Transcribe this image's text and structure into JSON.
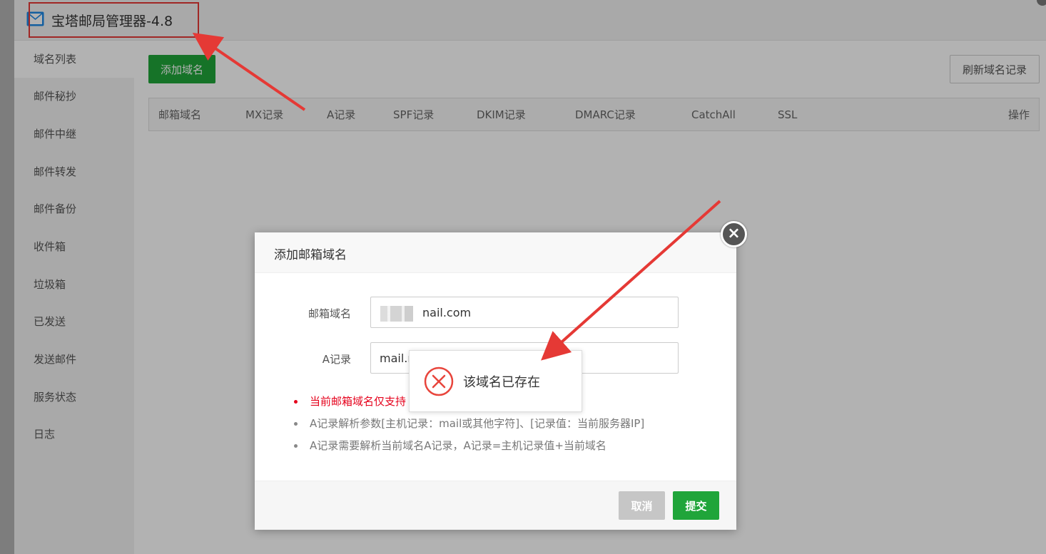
{
  "window": {
    "title": "宝塔邮局管理器-4.8"
  },
  "sidebar": {
    "items": [
      {
        "label": "域名列表"
      },
      {
        "label": "邮件秘抄"
      },
      {
        "label": "邮件中继"
      },
      {
        "label": "邮件转发"
      },
      {
        "label": "邮件备份"
      },
      {
        "label": "收件箱"
      },
      {
        "label": "垃圾箱"
      },
      {
        "label": "已发送"
      },
      {
        "label": "发送邮件"
      },
      {
        "label": "服务状态"
      },
      {
        "label": "日志"
      }
    ]
  },
  "toolbar": {
    "add_label": "添加域名",
    "refresh_label": "刷新域名记录"
  },
  "table": {
    "columns": [
      "邮箱域名",
      "MX记录",
      "A记录",
      "SPF记录",
      "DKIM记录",
      "DMARC记录",
      "CatchAll",
      "SSL",
      "操作"
    ]
  },
  "dialog": {
    "title": "添加邮箱域名",
    "domain_label": "邮箱域名",
    "domain_value": "nail.com",
    "a_label": "A记录",
    "a_value": "mail.r",
    "tips": [
      "当前邮箱域名仅支持",
      "A记录解析参数[主机记录：mail或其他字符]、[记录值：当前服务器IP]",
      "A记录需要解析当前域名A记录，A记录=主机记录值+当前域名"
    ],
    "cancel_label": "取消",
    "submit_label": "提交",
    "close_symbol": "×"
  },
  "toast": {
    "message": "该域名已存在"
  },
  "colors": {
    "accent_green": "#20a53a",
    "annotation_red": "#e53935",
    "tip_red": "#e5001b"
  }
}
